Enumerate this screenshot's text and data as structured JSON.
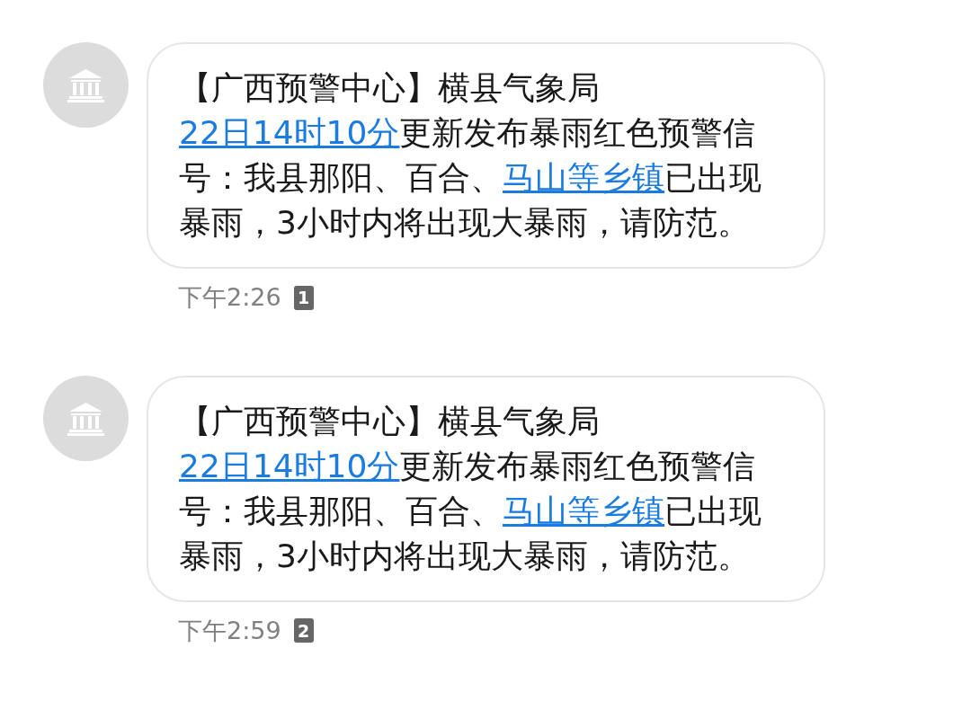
{
  "messages": [
    {
      "parts": [
        {
          "kind": "text",
          "text": "【广西预警中心】横县气象局"
        },
        {
          "kind": "link",
          "text": "22日14时10分"
        },
        {
          "kind": "text",
          "text": "更新发布暴雨红色预警信号：我县那阳、百合、"
        },
        {
          "kind": "link",
          "text": "马山等乡镇"
        },
        {
          "kind": "text",
          "text": "已出现暴雨，3小时内将出现大暴雨，请防范。"
        }
      ],
      "time": "下午2:26",
      "sim": "1"
    },
    {
      "parts": [
        {
          "kind": "text",
          "text": "【广西预警中心】横县气象局"
        },
        {
          "kind": "link",
          "text": "22日14时10分"
        },
        {
          "kind": "text",
          "text": "更新发布暴雨红色预警信号：我县那阳、百合、"
        },
        {
          "kind": "link",
          "text": "马山等乡镇"
        },
        {
          "kind": "text",
          "text": "已出现暴雨，3小时内将出现大暴雨，请防范。"
        }
      ],
      "time": "下午2:59",
      "sim": "2"
    }
  ]
}
